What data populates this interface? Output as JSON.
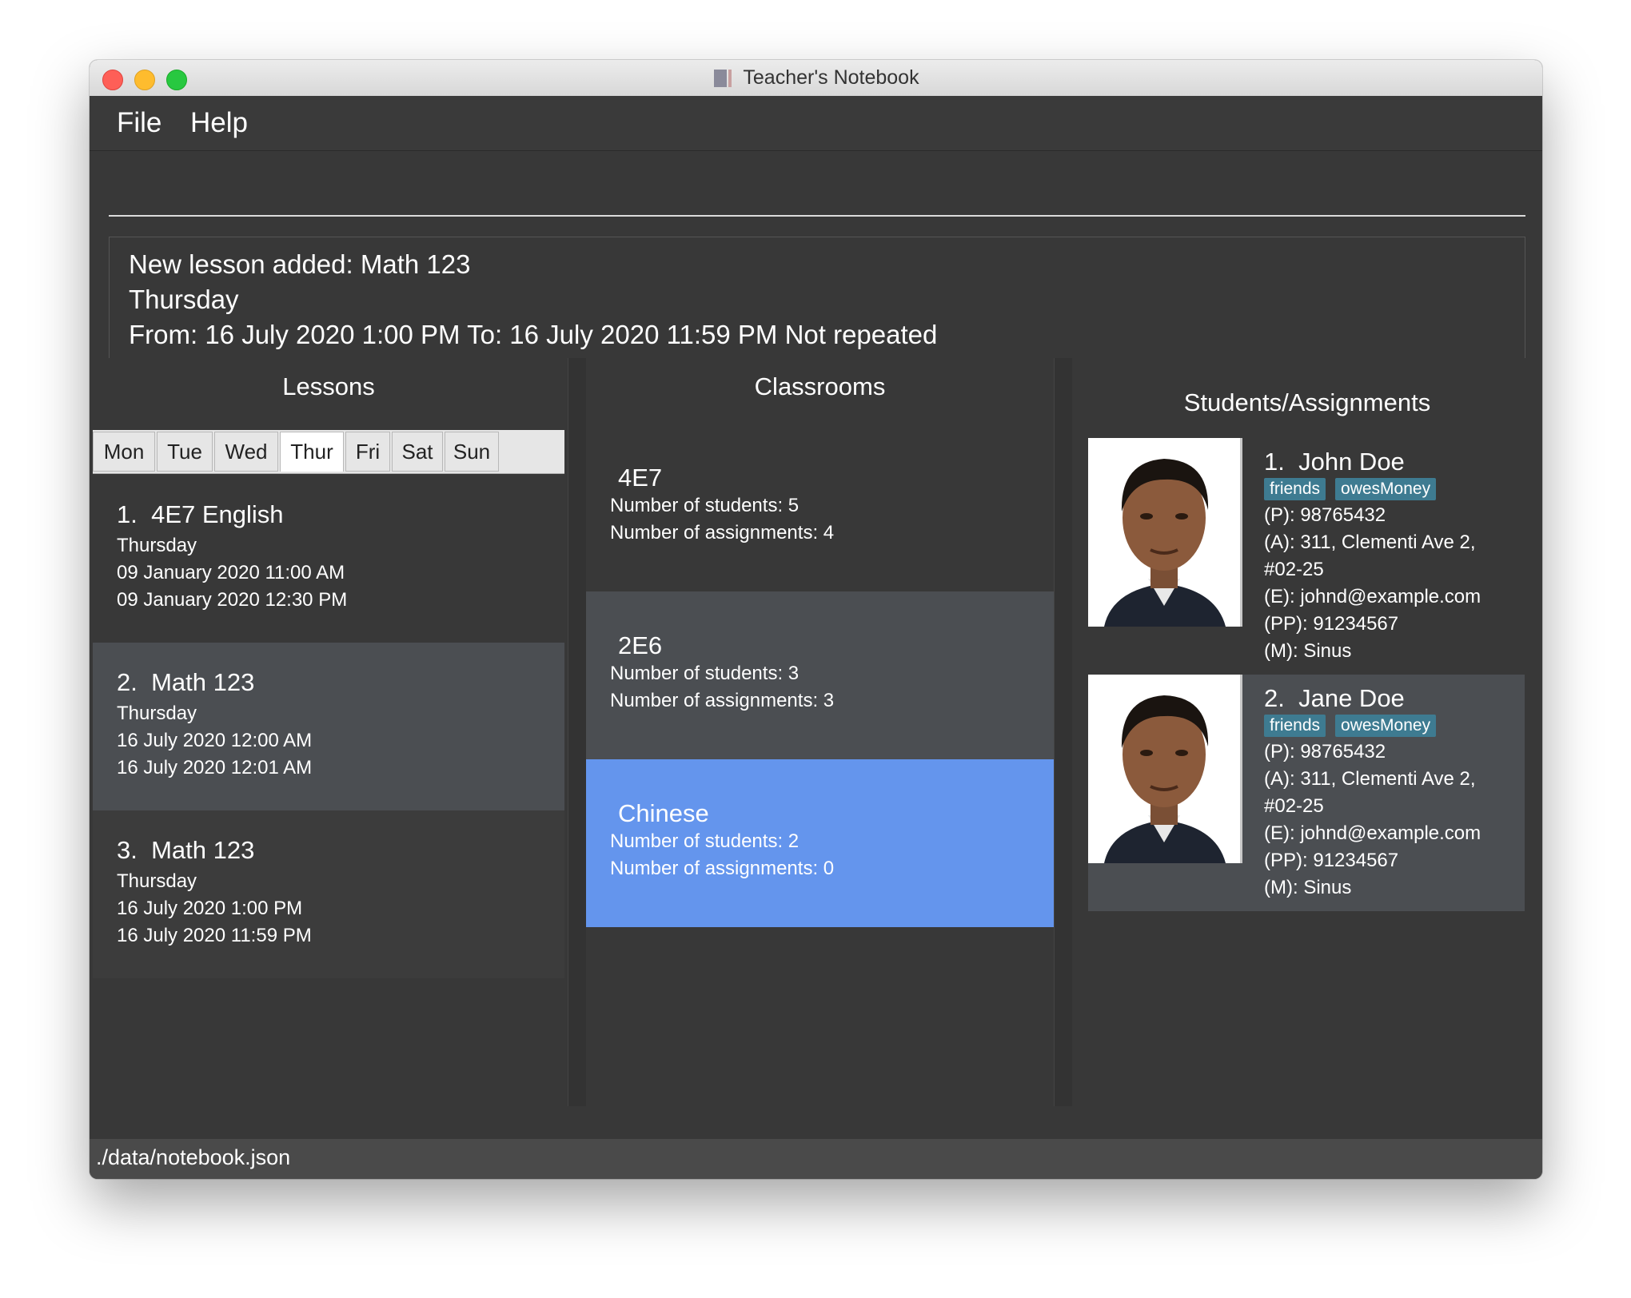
{
  "window": {
    "title": "Teacher's Notebook"
  },
  "menu": {
    "file": "File",
    "help": "Help"
  },
  "command": {
    "value": "",
    "placeholder": ""
  },
  "result": {
    "line1": "New lesson added: Math 123",
    "line2": "Thursday",
    "line3": "From: 16 July 2020 1:00 PM To: 16 July 2020 11:59 PM Not repeated"
  },
  "lessons": {
    "title": "Lessons",
    "days": [
      "Mon",
      "Tue",
      "Wed",
      "Thur",
      "Fri",
      "Sat",
      "Sun"
    ],
    "selected_day": "Thur",
    "items": [
      {
        "index": "1.",
        "name": "4E7 English",
        "day": "Thursday",
        "start": "09 January 2020 11:00 AM",
        "end": "09 January 2020 12:30 PM"
      },
      {
        "index": "2.",
        "name": "Math 123",
        "day": "Thursday",
        "start": "16 July 2020 12:00 AM",
        "end": "16 July 2020 12:01 AM"
      },
      {
        "index": "3.",
        "name": "Math 123",
        "day": "Thursday",
        "start": "16 July 2020 1:00 PM",
        "end": "16 July 2020 11:59 PM"
      }
    ]
  },
  "classrooms": {
    "title": "Classrooms",
    "items": [
      {
        "name": "4E7",
        "students": "Number of students: 5",
        "assignments": "Number of assignments: 4"
      },
      {
        "name": "2E6",
        "students": "Number of students: 3",
        "assignments": "Number of assignments: 3"
      },
      {
        "name": "Chinese",
        "students": "Number of students: 2",
        "assignments": "Number of assignments: 0"
      }
    ],
    "selected_color": "#6495ed"
  },
  "students": {
    "title": "Students/Assignments",
    "items": [
      {
        "index": "1.",
        "name": "John Doe",
        "tags": [
          "friends",
          "owesMoney"
        ],
        "phone": "(P): 98765432",
        "address1": "(A): 311, Clementi Ave 2,",
        "address2": "#02-25",
        "email": "(E): johnd@example.com",
        "parent_phone": "(PP): 91234567",
        "medical": "(M): Sinus"
      },
      {
        "index": "2.",
        "name": "Jane Doe",
        "tags": [
          "friends",
          "owesMoney"
        ],
        "phone": "(P): 98765432",
        "address1": "(A): 311, Clementi Ave 2,",
        "address2": "#02-25",
        "email": "(E): johnd@example.com",
        "parent_phone": "(PP): 91234567",
        "medical": "(M): Sinus"
      }
    ]
  },
  "status_bar": {
    "path": "./data/notebook.json"
  }
}
